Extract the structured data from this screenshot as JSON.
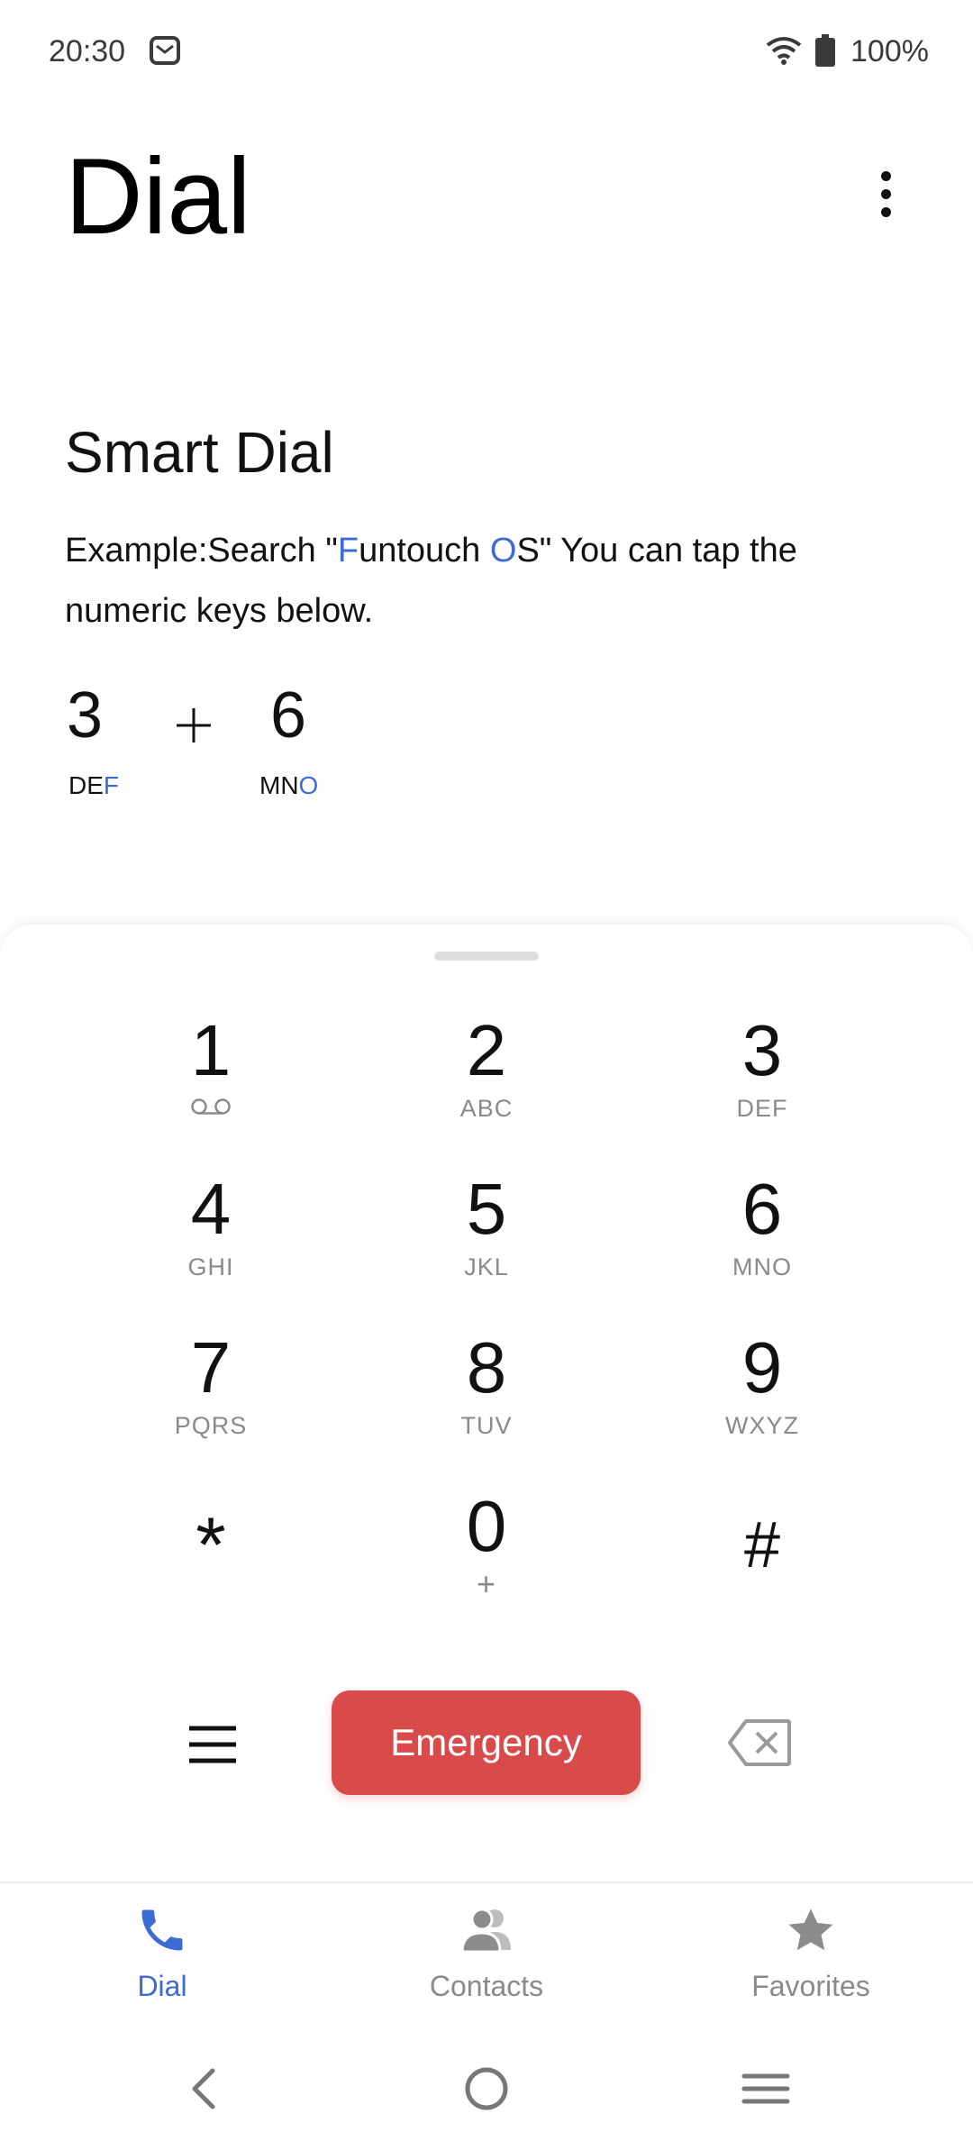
{
  "status_bar": {
    "time": "20:30",
    "battery": "100%",
    "icons": [
      "mail-icon",
      "wifi-icon",
      "battery-icon"
    ]
  },
  "header": {
    "title": "Dial",
    "more_icon": "more-vertical-icon"
  },
  "smart_dial": {
    "title": "Smart Dial",
    "text_prefix": "Example:Search \"",
    "highlight_1": "F",
    "text_mid": "untouch ",
    "highlight_2": "O",
    "text_suffix": "S\" You can tap the numeric keys below.",
    "example": [
      {
        "digit": "3",
        "letters": "DE",
        "highlight": "F"
      },
      {
        "digit": "6",
        "letters": "MN",
        "highlight": "O"
      }
    ],
    "plus": "+"
  },
  "keypad": {
    "keys": [
      {
        "digit": "1",
        "letters": ""
      },
      {
        "digit": "2",
        "letters": "ABC"
      },
      {
        "digit": "3",
        "letters": "DEF"
      },
      {
        "digit": "4",
        "letters": "GHI"
      },
      {
        "digit": "5",
        "letters": "JKL"
      },
      {
        "digit": "6",
        "letters": "MNO"
      },
      {
        "digit": "7",
        "letters": "PQRS"
      },
      {
        "digit": "8",
        "letters": "TUV"
      },
      {
        "digit": "9",
        "letters": "WXYZ"
      },
      {
        "digit": "*",
        "letters": ""
      },
      {
        "digit": "0",
        "letters": "+"
      },
      {
        "digit": "#",
        "letters": ""
      }
    ],
    "voicemail_icon": "voicemail-icon"
  },
  "actions": {
    "emergency_label": "Emergency",
    "menu_icon": "menu-icon",
    "backspace_icon": "backspace-icon"
  },
  "bottom_nav": {
    "items": [
      {
        "label": "Dial",
        "icon": "phone-icon",
        "active": true
      },
      {
        "label": "Contacts",
        "icon": "contacts-icon",
        "active": false
      },
      {
        "label": "Favorites",
        "icon": "star-icon",
        "active": false
      }
    ]
  },
  "colors": {
    "accent": "#3c6bd6",
    "emergency": "#d84b4a",
    "muted": "#8a8a8a"
  }
}
